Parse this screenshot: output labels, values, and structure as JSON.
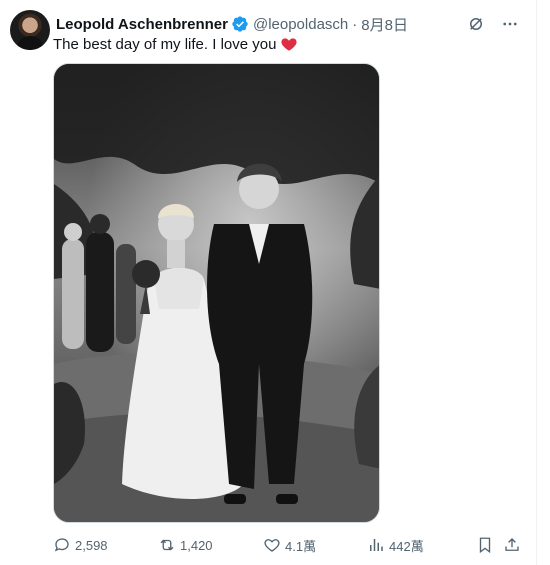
{
  "tweet": {
    "author_name": "Leopold Aschenbrenner",
    "handle": "@leopoldasch",
    "separator": "·",
    "date": "8月8日",
    "text": "The best day of my life. I love you",
    "icons": {
      "verified": "verified-badge-icon",
      "grok": "grok-icon",
      "more": "more-icon",
      "heart": "red-heart-emoji",
      "reply": "reply-icon",
      "retweet": "retweet-icon",
      "like": "like-icon",
      "views": "views-icon",
      "bookmark": "bookmark-icon",
      "share": "share-icon"
    },
    "colors": {
      "verified": "#1d9bf0",
      "heart": "#dd2e44",
      "muted": "#536471",
      "text": "#0f1419"
    }
  },
  "actions": {
    "replies": "2,598",
    "retweets": "1,420",
    "likes": "4.1萬",
    "views": "442萬"
  }
}
